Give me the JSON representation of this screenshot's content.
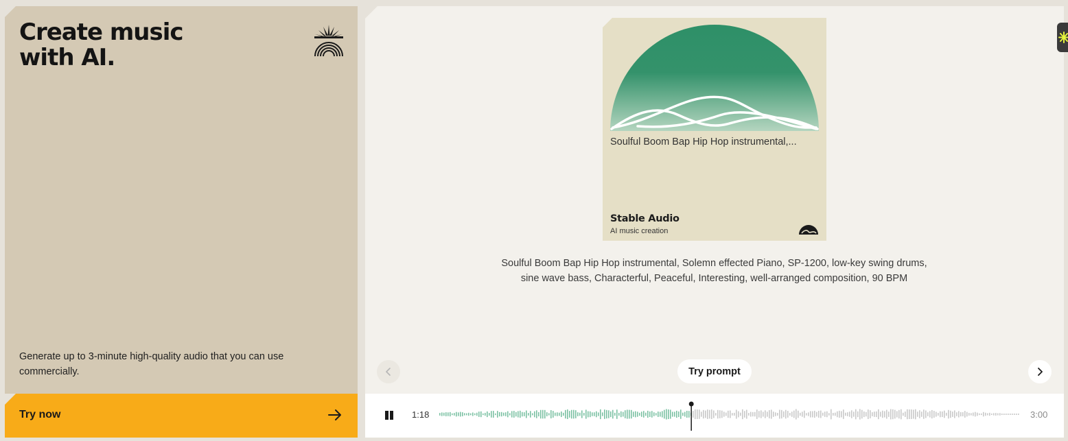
{
  "hero": {
    "title_line1": "Create music",
    "title_line2": "with AI.",
    "description": "Generate up to 3-minute high-quality audio that you can use commercially.",
    "cta_label": "Try now"
  },
  "card": {
    "title": "Soulful Boom Bap Hip Hop instrumental,...",
    "brand": "Stable Audio",
    "subtitle": "AI music creation"
  },
  "prompt": {
    "text": "Soulful Boom Bap Hip Hop instrumental, Solemn effected Piano, SP-1200, low-key swing drums, sine wave bass, Characterful, Peaceful, Interesting, well-arranged composition, 90 BPM",
    "try_label": "Try prompt"
  },
  "player": {
    "current_time": "1:18",
    "total_time": "3:00",
    "progress": 0.433,
    "played_color": "#7bc1a3",
    "unplayed_color": "#c9c9c9"
  },
  "colors": {
    "accent": "#f8ab18",
    "green": "#2e9068"
  }
}
